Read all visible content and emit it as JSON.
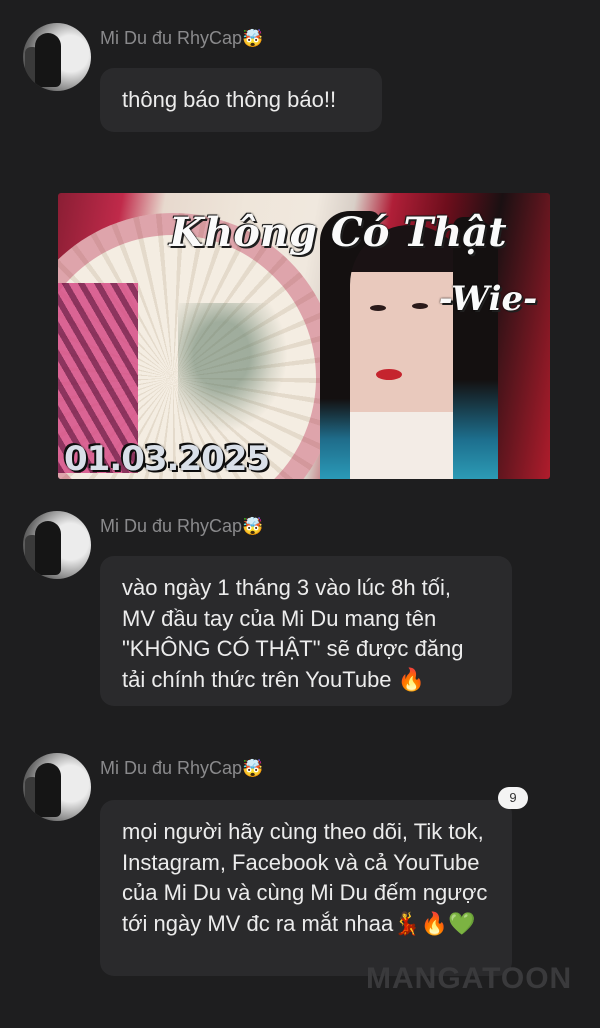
{
  "messages": [
    {
      "username": "Mi Du đu RhyCap",
      "username_emoji": "🤯",
      "text": "thông báo thông báo!!"
    },
    {
      "image": {
        "title": "Không Có Thật",
        "subtitle": "-Wie-",
        "date": "01.03.2025"
      }
    },
    {
      "username": "Mi Du đu RhyCap",
      "username_emoji": "🤯",
      "text": "vào ngày 1 tháng 3 vào lúc 8h tối, MV đầu tay của Mi Du mang tên \"KHÔNG CÓ THẬT\" sẽ được đăng tải chính thức trên YouTube 🔥"
    },
    {
      "username": "Mi Du đu RhyCap",
      "username_emoji": "🤯",
      "text": "mọi người hãy cùng theo dõi, Tik tok, Instagram, Facebook và cả YouTube của Mi Du và cùng Mi Du đếm ngược tới ngày MV đc ra mắt nhaa💃🔥💚",
      "reaction_count": "9"
    }
  ],
  "watermark": "MANGATOON",
  "colors": {
    "background": "#1e1e1f",
    "bubble": "#2a2a2c",
    "text": "#ececec",
    "username": "#8a8a8c"
  }
}
